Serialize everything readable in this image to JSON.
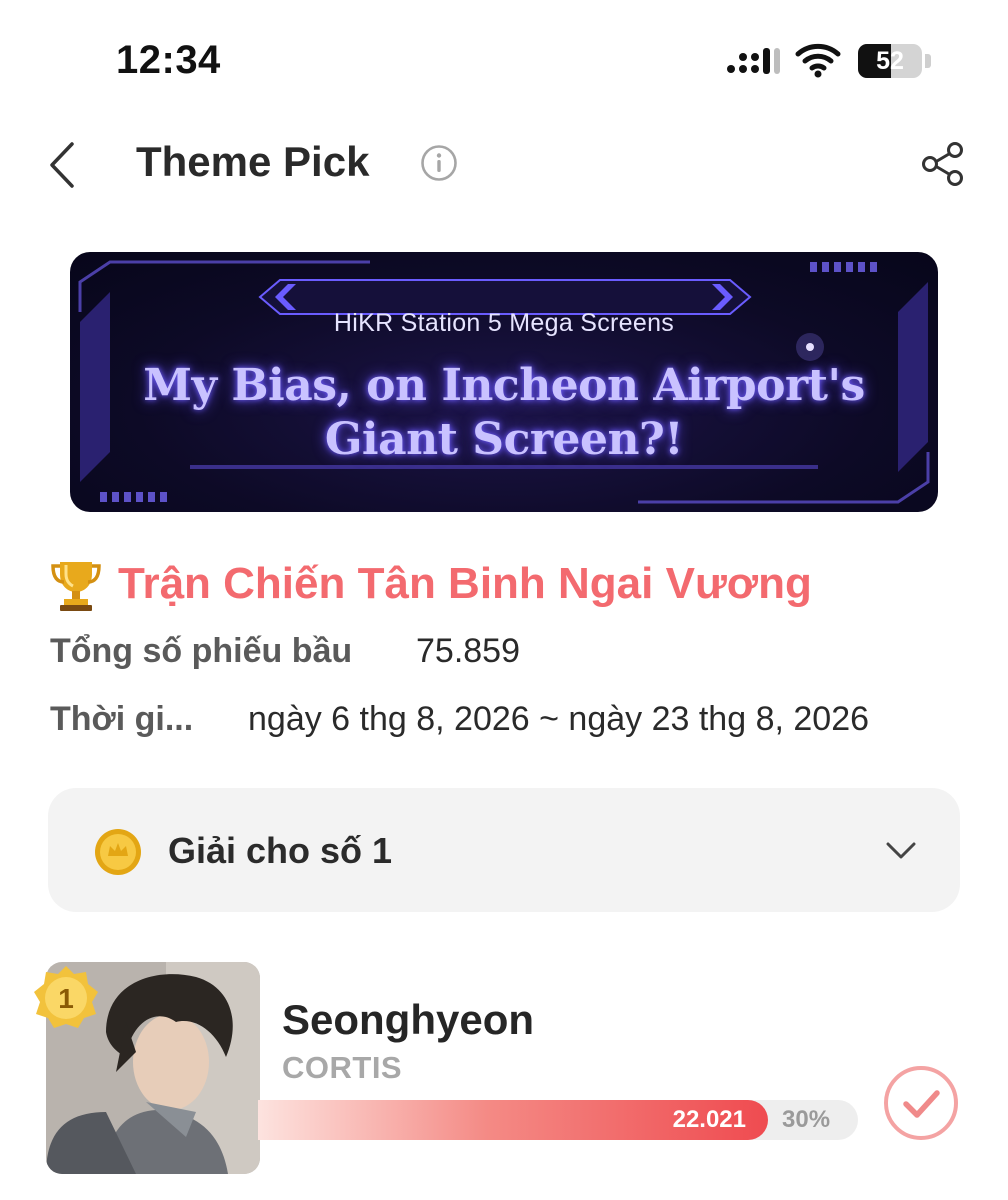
{
  "status_bar": {
    "time": "12:34",
    "battery": "52",
    "battery_level": 0.52
  },
  "header": {
    "title": "Theme Pick"
  },
  "banner": {
    "subtitle": "HiKR Station 5 Mega Screens",
    "headline_line1": "My Bias, on Incheon Airport's",
    "headline_line2": "Giant Screen?!"
  },
  "event": {
    "title": "Trận Chiến Tân Binh Ngai Vương",
    "total_votes_label": "Tổng số phiếu bầu",
    "total_votes_value": "75.859",
    "period_label": "Thời gi...",
    "period_value": "ngày 6 thg 8, 2026 ~ ngày 23 thg 8, 2026"
  },
  "prize": {
    "label": "Giải cho số 1"
  },
  "candidates": [
    {
      "rank": "1",
      "name": "Seonghyeon",
      "group": "CORTIS",
      "votes": "22.021",
      "percent": "30%",
      "share": 0.3
    }
  ],
  "colors": {
    "accent": "#f36a6f",
    "bar_end": "#ef4b50",
    "banner_text": "#c9c2ff"
  },
  "icons": [
    "back-chevron-icon",
    "info-icon",
    "share-icon",
    "trophy-icon",
    "coin-icon",
    "chevron-down-icon",
    "check-circle-icon",
    "rank-badge-icon"
  ]
}
